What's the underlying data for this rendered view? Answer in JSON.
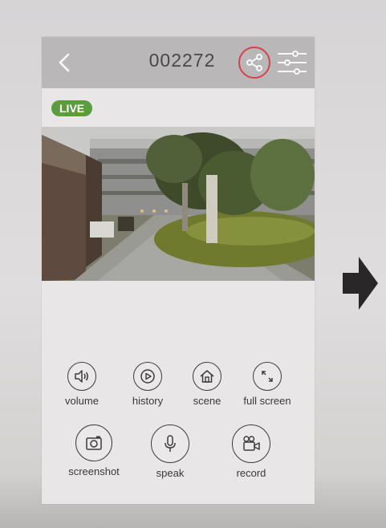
{
  "header": {
    "title": "002272"
  },
  "live_badge": "LIVE",
  "controls": {
    "volume": "volume",
    "history": "history",
    "scene": "scene",
    "full_screen": "full screen",
    "screenshot": "screenshot",
    "speak": "speak",
    "record": "record"
  },
  "colors": {
    "topbar": "#b9b7b8",
    "live": "#5d9b3f",
    "share_highlight": "#d9414a",
    "icon_stroke": "#3e3b3c"
  }
}
